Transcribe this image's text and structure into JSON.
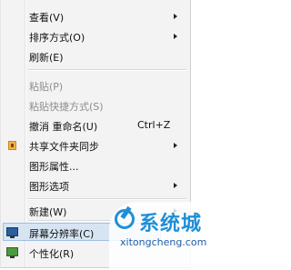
{
  "menu": {
    "view": {
      "label": "查看(V)",
      "submenu": true
    },
    "sort": {
      "label": "排序方式(O)",
      "submenu": true
    },
    "refresh": {
      "label": "刷新(E)"
    },
    "paste": {
      "label": "粘贴(P)",
      "disabled": true
    },
    "paste_shortcut": {
      "label": "粘贴快捷方式(S)",
      "disabled": true
    },
    "undo_rename": {
      "label": "撤消 重命名(U)",
      "shortcut": "Ctrl+Z"
    },
    "share_sync": {
      "label": "共享文件夹同步",
      "submenu": true,
      "icon": "share-folder-icon"
    },
    "graphics_properties": {
      "label": "图形属性..."
    },
    "graphics_options": {
      "label": "图形选项",
      "submenu": true
    },
    "new": {
      "label": "新建(W)",
      "submenu": true
    },
    "screen_resolution": {
      "label": "屏幕分辨率(C)",
      "icon": "monitor-icon",
      "highlighted": true
    },
    "personalize": {
      "label": "个性化(R)",
      "icon": "personalize-icon"
    }
  },
  "watermark": {
    "title": "系统城",
    "url": "xitongcheng.com",
    "logo_color": "#1e8fd8"
  },
  "colors": {
    "menu_bg": "#f3f3f3",
    "highlight": "#d7e5f3",
    "disabled_text": "#8d8d8d"
  }
}
